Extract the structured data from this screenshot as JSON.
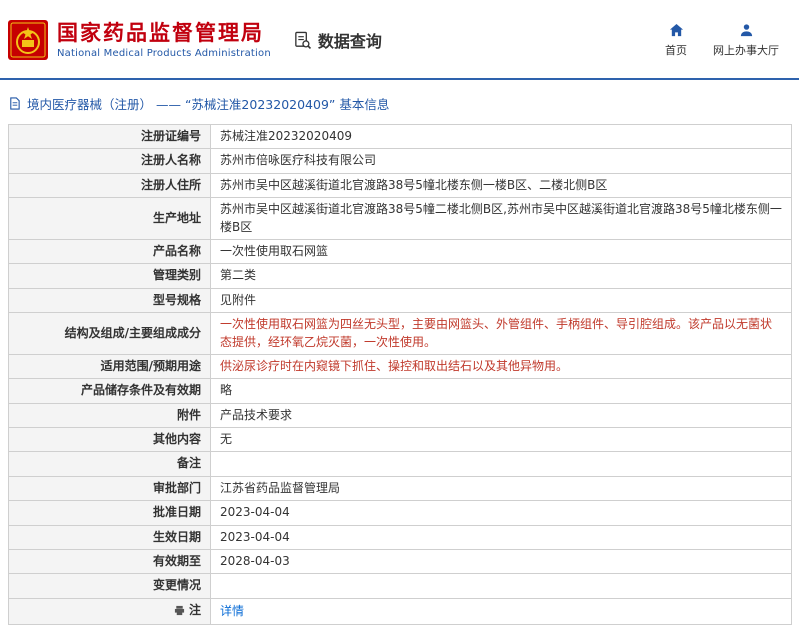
{
  "header": {
    "org_name_cn": "国家药品监督管理局",
    "org_name_en": "National Medical Products Administration",
    "section_title": "数据查询",
    "nav": [
      {
        "label": "首页",
        "icon": "home-icon"
      },
      {
        "label": "网上办事大厅",
        "icon": "person-icon"
      }
    ]
  },
  "breadcrumb": {
    "icon": "document-icon",
    "text": "境内医疗器械（注册） ——  “苏械注准20232020409” 基本信息"
  },
  "colors": {
    "brand_red": "#c1000e",
    "brand_blue": "#2358a7",
    "divider_blue": "#2e62ad",
    "highlight_red": "#c0392b",
    "link_blue": "#0a6cd6",
    "label_bg": "#f4f4f4"
  },
  "table": {
    "rows": [
      {
        "label": "注册证编号",
        "value": "苏械注准20232020409"
      },
      {
        "label": "注册人名称",
        "value": "苏州市倍咏医疗科技有限公司"
      },
      {
        "label": "注册人住所",
        "value": "苏州市吴中区越溪街道北官渡路38号5幢北楼东侧一楼B区、二楼北侧B区"
      },
      {
        "label": "生产地址",
        "value": "苏州市吴中区越溪街道北官渡路38号5幢二楼北侧B区,苏州市吴中区越溪街道北官渡路38号5幢北楼东侧一楼B区"
      },
      {
        "label": "产品名称",
        "value": "一次性使用取石网篮"
      },
      {
        "label": "管理类别",
        "value": "第二类"
      },
      {
        "label": "型号规格",
        "value": "见附件"
      },
      {
        "label": "结构及组成/主要组成成分",
        "value": "一次性使用取石网篮为四丝无头型，主要由网篮头、外管组件、手柄组件、导引腔组成。该产品以无菌状态提供，经环氧乙烷灭菌，一次性使用。"
      },
      {
        "label": "适用范围/预期用途",
        "value": "供泌尿诊疗时在内窥镜下抓住、操控和取出结石以及其他异物用。"
      },
      {
        "label": "产品储存条件及有效期",
        "value": "略"
      },
      {
        "label": "附件",
        "value": "产品技术要求"
      },
      {
        "label": "其他内容",
        "value": "无"
      },
      {
        "label": "备注",
        "value": ""
      },
      {
        "label": "审批部门",
        "value": "江苏省药品监督管理局"
      },
      {
        "label": "批准日期",
        "value": "2023-04-04"
      },
      {
        "label": "生效日期",
        "value": "2023-04-04"
      },
      {
        "label": "有效期至",
        "value": "2028-04-03"
      },
      {
        "label": "变更情况",
        "value": ""
      },
      {
        "label": "注",
        "value": "详情"
      }
    ]
  }
}
